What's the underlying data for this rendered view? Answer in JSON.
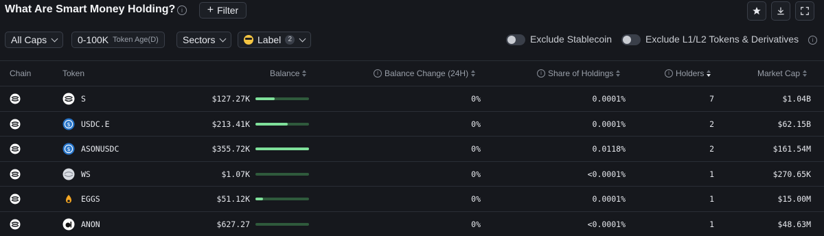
{
  "header": {
    "title": "What Are Smart Money Holding?",
    "filter_label": "Filter"
  },
  "filters": {
    "caps": "All Caps",
    "age_value": "0-100K",
    "age_label": "Token Age(D)",
    "sectors": "Sectors",
    "label": "Label",
    "label_count": "2",
    "exclude_stablecoin": "Exclude Stablecoin",
    "exclude_l1l2": "Exclude L1/L2 Tokens & Derivatives"
  },
  "table": {
    "columns": {
      "chain": "Chain",
      "token": "Token",
      "balance": "Balance",
      "balance_change": "Balance Change (24H)",
      "share": "Share of Holdings",
      "holders": "Holders",
      "market_cap": "Market Cap"
    },
    "rows": [
      {
        "token": "S",
        "balance": "$127.27K",
        "bar_fraction": 0.36,
        "change": "0%",
        "share": "0.0001%",
        "holders": "7",
        "mcap": "$1.04B",
        "icon": "sonic-icon"
      },
      {
        "token": "USDC.E",
        "balance": "$213.41K",
        "bar_fraction": 0.6,
        "change": "0%",
        "share": "0.0001%",
        "holders": "2",
        "mcap": "$62.15B",
        "icon": "usdc-icon"
      },
      {
        "token": "ASONUSDC",
        "balance": "$355.72K",
        "bar_fraction": 1.0,
        "change": "0%",
        "share": "0.0118%",
        "holders": "2",
        "mcap": "$161.54M",
        "icon": "usdc-icon"
      },
      {
        "token": "WS",
        "balance": "$1.07K",
        "bar_fraction": 0.0,
        "change": "0%",
        "share": "<0.0001%",
        "holders": "1",
        "mcap": "$270.65K",
        "icon": "wrapped-sonic-icon"
      },
      {
        "token": "EGGS",
        "balance": "$51.12K",
        "bar_fraction": 0.14,
        "change": "0%",
        "share": "0.0001%",
        "holders": "1",
        "mcap": "$15.00M",
        "icon": "eggs-icon"
      },
      {
        "token": "ANON",
        "balance": "$627.27",
        "bar_fraction": 0.0,
        "change": "0%",
        "share": "<0.0001%",
        "holders": "1",
        "mcap": "$48.63M",
        "icon": "anon-icon"
      }
    ]
  },
  "colors": {
    "background": "#16181d",
    "bar_track": "#2f5a3c",
    "bar_fill": "#7fe09a",
    "usdc_blue": "#2775ca",
    "eggs_orange": "#f5a623"
  }
}
